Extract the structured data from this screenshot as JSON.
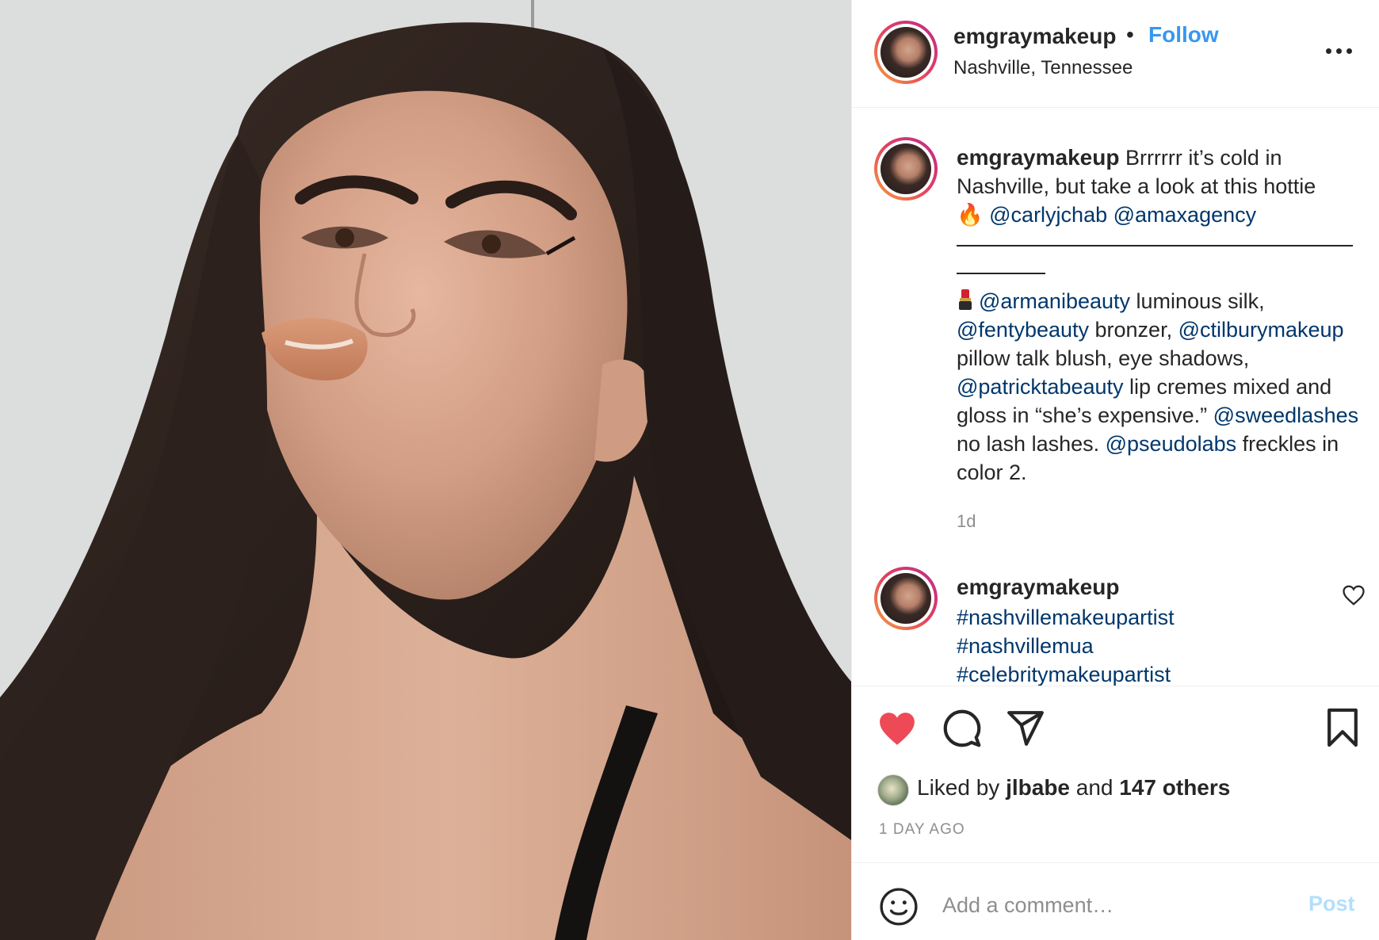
{
  "post": {
    "author": "emgraymakeup",
    "separator": "•",
    "follow_label": "Follow",
    "location": "Nashville, Tennessee",
    "more_icon": "more-horizontal-icon"
  },
  "caption": {
    "author": "emgraymakeup",
    "text": " Brrrrrr it’s cold in Nashville, but take a look at this hottie ",
    "fire_emoji": "🔥",
    "mentions": [
      "@carlyjchab",
      "@amaxagency"
    ],
    "products": {
      "m1": "@armanibeauty",
      "t1": " luminous silk, ",
      "m2": "@fentybeauty",
      "t2": " bronzer, ",
      "m3": "@ctilburymakeup",
      "t3": " pillow talk blush, eye shadows, ",
      "m4": "@patricktabeauty",
      "t4": " lip cremes mixed and gloss in “she’s expensive.” ",
      "m5": "@sweedlashes",
      "t5": " no lash lashes. ",
      "m6": "@pseudolabs",
      "t6": " freckles in color 2."
    },
    "time": "1d"
  },
  "comment2": {
    "author": "emgraymakeup",
    "tags": [
      "#nashvillemakeupartist",
      "#nashvillemua",
      "#celebritymakeupartist"
    ]
  },
  "actions": {
    "icons": [
      "heart-filled-icon",
      "comment-icon",
      "share-icon",
      "bookmark-icon"
    ],
    "liked_prefix": "Liked by ",
    "liked_user": "jlbabe",
    "liked_middle": " and ",
    "liked_others": "147 others",
    "time_ago": "1 DAY AGO"
  },
  "comment_box": {
    "placeholder": "Add a comment…",
    "post_label": "Post"
  },
  "colors": {
    "link_blue": "#3897f0",
    "mention_blue": "#00376b",
    "like_red": "#ed4956",
    "muted": "#8e8e8e",
    "post_disabled": "#b2dffc"
  }
}
